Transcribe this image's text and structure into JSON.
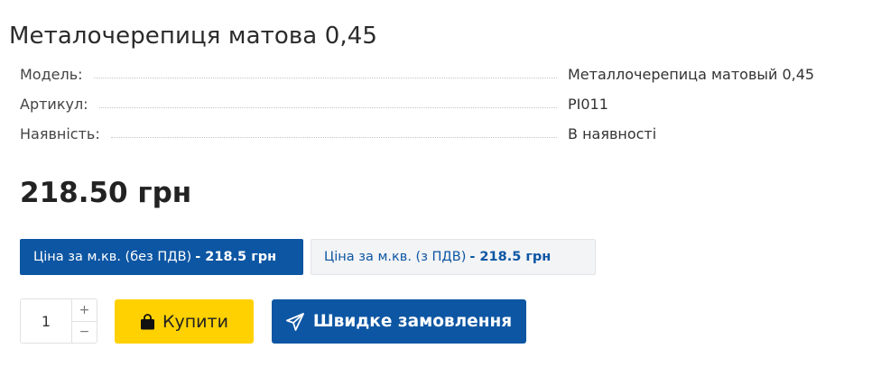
{
  "product": {
    "title": "Металочерепиця матова 0,45",
    "specs": [
      {
        "label": "Модель:",
        "value": "Металлочерепица матовый 0,45"
      },
      {
        "label": "Артикул:",
        "value": "PI011"
      },
      {
        "label": "Наявність:",
        "value": "В наявності"
      }
    ],
    "price": "218.50 грн"
  },
  "price_options": {
    "without_vat": {
      "label": "Ціна за м.кв. (без ПДВ)",
      "amount": "- 218.5 грн"
    },
    "with_vat": {
      "label": "Ціна за м.кв. (з ПДВ)",
      "amount": "- 218.5 грн"
    }
  },
  "quantity": {
    "value": "1",
    "plus": "+",
    "minus": "−"
  },
  "buttons": {
    "buy": "Купити",
    "quick_order": "Швидке замовлення"
  },
  "colors": {
    "brand_blue": "#0d56a3",
    "buy_yellow": "#ffd100"
  },
  "icons": {
    "buy": "shopping-bag-icon",
    "quick_order": "paper-plane-icon"
  }
}
